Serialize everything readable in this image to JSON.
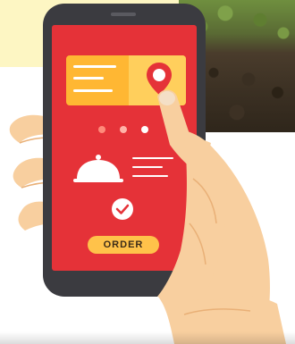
{
  "screen": {
    "background_color": "#e53238",
    "location_card": {
      "color": "#ffb733",
      "accent_color": "#ffcf5c",
      "icon": "map-pin-icon"
    },
    "pagination": {
      "count": 3,
      "active_index": 2
    },
    "dish_icon": "cloche-icon",
    "confirm_icon": "checkmark-icon",
    "order_button": {
      "label": "ORDER",
      "color": "#ffc24a"
    }
  },
  "background": {
    "banner_color": "#fdf6c3",
    "photo": "soil-photo"
  }
}
